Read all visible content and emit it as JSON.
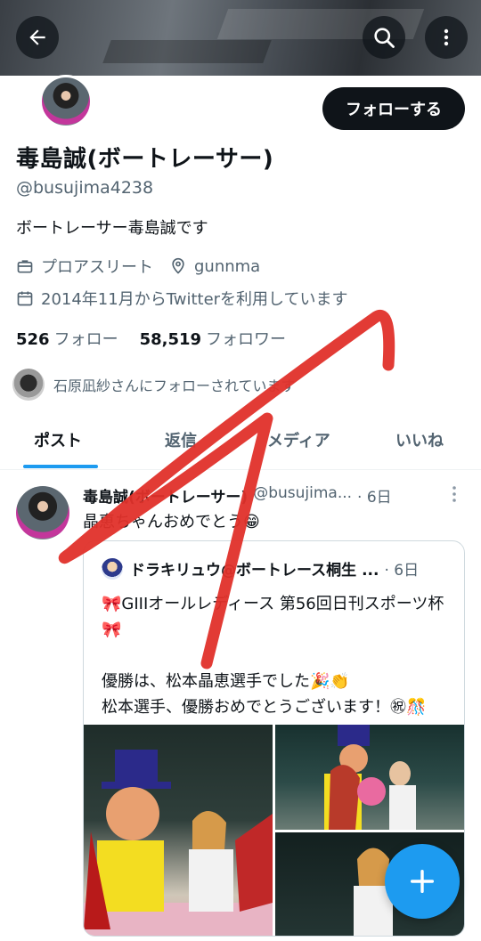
{
  "header": {
    "back_icon": "arrow-left-icon",
    "search_icon": "search-icon",
    "more_icon": "more-vertical-icon"
  },
  "profile": {
    "follow_label": "フォローする",
    "name": "毒島誠(ボートレーサー)",
    "handle": "@busujima4238",
    "bio": "ボートレーサー毒島誠です",
    "category": "プロアスリート",
    "location": "gunnma",
    "joined": "2014年11月からTwitterを利用しています",
    "following_count": "526",
    "following_label": "フォロー",
    "followers_count": "58,519",
    "followers_label": "フォロワー",
    "followed_by": "石原凪紗さんにフォローされています"
  },
  "tabs": [
    {
      "label": "ポスト"
    },
    {
      "label": "返信"
    },
    {
      "label": "メディア"
    },
    {
      "label": "いいね"
    }
  ],
  "post": {
    "name": "毒島誠(ボートレーサー)",
    "handle": "@busujima...",
    "time": "· 6日",
    "text": "晶恵ちゃんおめでとう😁",
    "quote": {
      "name": "ドラキリュウ@ボートレース桐生 ...",
      "time": "· 6日",
      "text": "🎀GIIIオールレディース 第56回日刊スポーツ杯🎀\n\n優勝は、松本晶恵選手でした🎉👏\n松本選手、優勝おめでとうございます！㊗🎊"
    }
  },
  "colors": {
    "accent": "#1d9bf0",
    "text_primary": "#0f1419",
    "text_secondary": "#536471",
    "annotation": "#e0302a"
  }
}
